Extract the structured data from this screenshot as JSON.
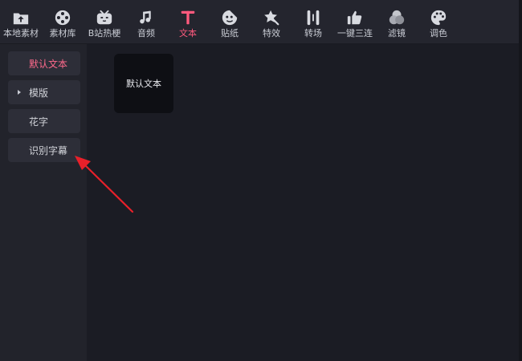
{
  "toolbar": {
    "tools": [
      {
        "id": "local-assets",
        "label": "本地素材",
        "icon": "upload-folder-icon"
      },
      {
        "id": "asset-library",
        "label": "素材库",
        "icon": "film-reel-icon"
      },
      {
        "id": "bilibili-memes",
        "label": "B站热梗",
        "icon": "tv-mascot-icon"
      },
      {
        "id": "audio",
        "label": "音频",
        "icon": "music-note-icon"
      },
      {
        "id": "text",
        "label": "文本",
        "icon": "text-t-icon"
      },
      {
        "id": "stickers",
        "label": "贴纸",
        "icon": "sticker-face-icon"
      },
      {
        "id": "effects",
        "label": "特效",
        "icon": "star-wand-icon"
      },
      {
        "id": "transitions",
        "label": "转场",
        "icon": "transition-bars-icon"
      },
      {
        "id": "triple",
        "label": "一键三连",
        "icon": "thumbs-up-icon"
      },
      {
        "id": "filters",
        "label": "滤镜",
        "icon": "filter-circles-icon"
      },
      {
        "id": "color",
        "label": "调色",
        "icon": "palette-icon"
      }
    ],
    "active": "text",
    "active_color": "#ff5a7e"
  },
  "sidebar": {
    "items": [
      {
        "label": "默认文本",
        "active": true
      },
      {
        "label": "模版",
        "expandable": true
      },
      {
        "label": "花字"
      },
      {
        "label": "识别字幕"
      }
    ]
  },
  "main": {
    "cards": [
      {
        "label": "默认文本"
      }
    ]
  },
  "annotation": {
    "type": "arrow",
    "color": "#e8202a",
    "points_to": "识别字幕"
  }
}
